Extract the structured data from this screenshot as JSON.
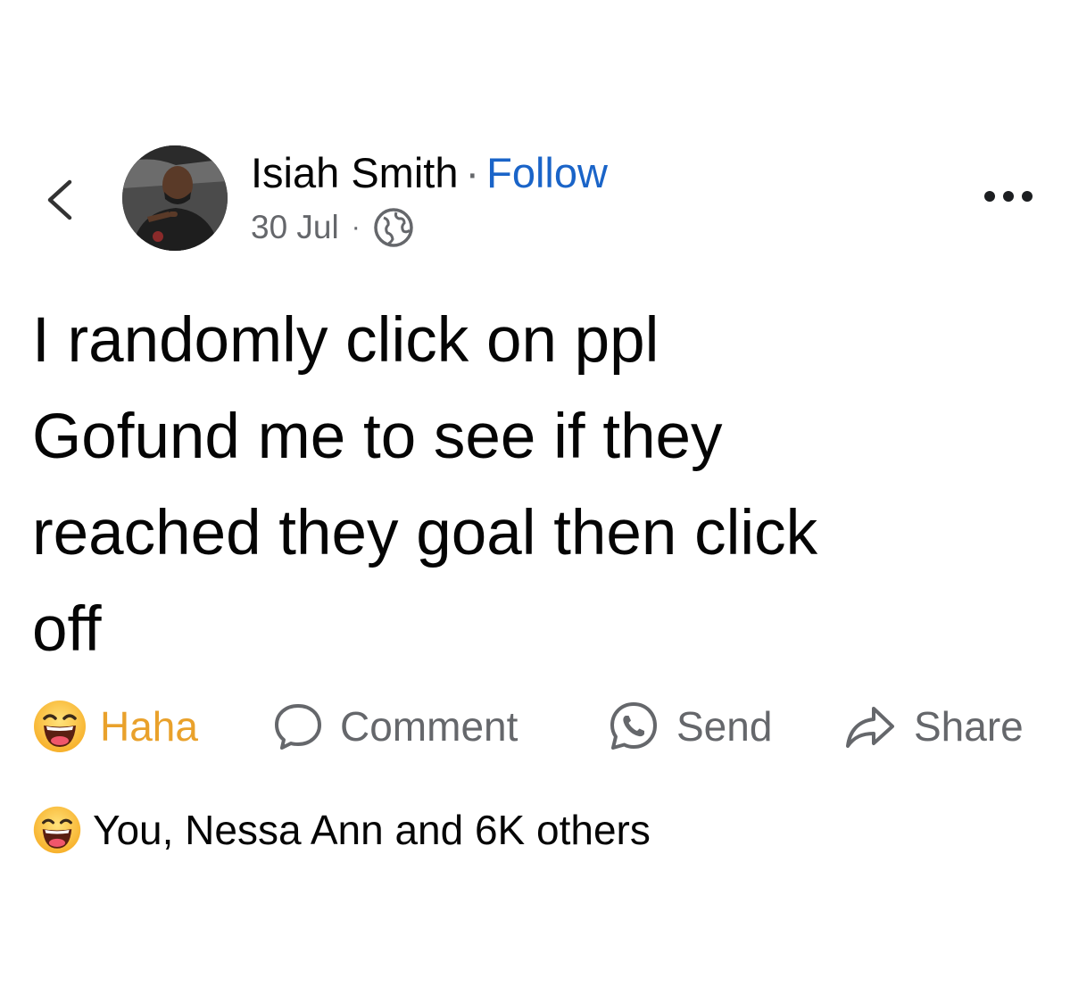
{
  "header": {
    "author_name": "Isiah Smith",
    "separator": "·",
    "follow_label": "Follow",
    "date": "30 Jul",
    "meta_separator": "·",
    "privacy_icon": "globe-icon",
    "back_icon": "chevron-left-icon",
    "more_icon": "more-dots-icon"
  },
  "post": {
    "lines": [
      "I randomly click on ppl",
      "Gofund me to see if they",
      "reached they goal then click",
      "off"
    ]
  },
  "actions": {
    "haha_label": "Haha",
    "comment_label": "Comment",
    "send_label": "Send",
    "share_label": "Share"
  },
  "reactions": {
    "summary": "You, Nessa Ann and 6K others"
  },
  "colors": {
    "follow": "#1a64c8",
    "haha": "#e9a12b",
    "muted": "#65676b",
    "text": "#050505"
  }
}
